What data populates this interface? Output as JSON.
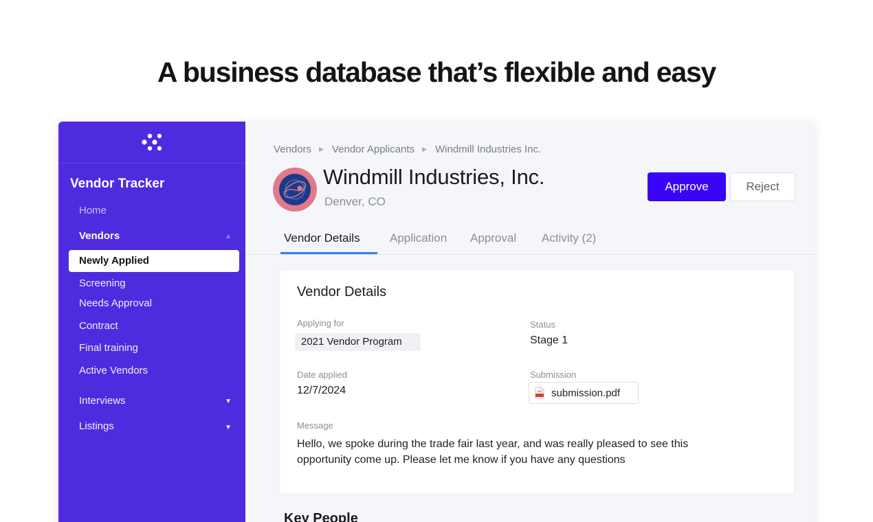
{
  "headline": "A business database that’s flexible and easy",
  "sidebar": {
    "app_title": "Vendor Tracker",
    "items": [
      {
        "label": "Home"
      },
      {
        "label": "Vendors",
        "caret": "▲"
      },
      {
        "label": "Newly Applied"
      },
      {
        "label": "Screening"
      },
      {
        "label": "Needs Approval"
      },
      {
        "label": "Contract"
      },
      {
        "label": "Final training"
      },
      {
        "label": "Active Vendors"
      },
      {
        "label": "Interviews",
        "caret": "▼"
      },
      {
        "label": "Listings",
        "caret": "▼"
      }
    ]
  },
  "breadcrumb": {
    "items": [
      "Vendors",
      "Vendor Applicants",
      "Windmill Industries Inc."
    ],
    "separator": "▶"
  },
  "vendor": {
    "name": "Windmill Industries, Inc.",
    "location": "Denver, CO"
  },
  "actions": {
    "approve_label": "Approve",
    "reject_label": "Reject"
  },
  "tabs": [
    {
      "label": "Vendor Details",
      "active": true
    },
    {
      "label": "Application"
    },
    {
      "label": "Approval"
    },
    {
      "label": "Activity (2)"
    }
  ],
  "details": {
    "title": "Vendor Details",
    "applying_for_label": "Applying for",
    "applying_for_value": "2021 Vendor Program",
    "status_label": "Status",
    "status_value": "Stage 1",
    "date_applied_label": "Date applied",
    "date_applied_value": "12/7/2024",
    "submission_label": "Submission",
    "submission_file": "submission.pdf",
    "message_label": "Message",
    "message_value": "Hello, we spoke during the trade fair last year, and was really pleased to see this opportunity come up. Please let me know if you have any questions"
  },
  "key_people": {
    "title": "Key People"
  },
  "colors": {
    "sidebar_bg": "#4f2bdf",
    "approve_bg": "#3a05f5",
    "tab_accent": "#2f80ed",
    "avatar_bg": "#e17a8a"
  }
}
